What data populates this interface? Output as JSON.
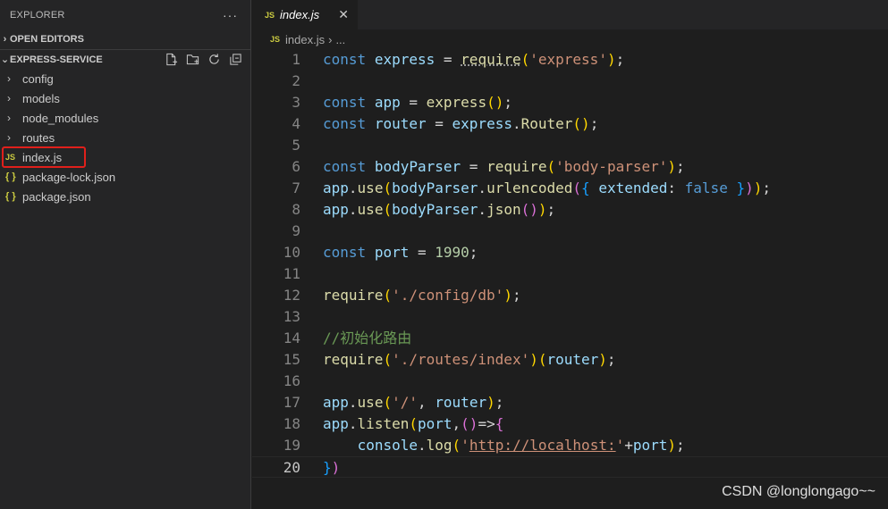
{
  "explorer": {
    "title": "EXPLORER",
    "more": "···",
    "open_editors": "OPEN EDITORS",
    "project": "EXPRESS-SERVICE",
    "items": [
      {
        "label": "config",
        "type": "folder"
      },
      {
        "label": "models",
        "type": "folder"
      },
      {
        "label": "node_modules",
        "type": "folder"
      },
      {
        "label": "routes",
        "type": "folder"
      },
      {
        "label": "index.js",
        "type": "js",
        "badge": "JS"
      },
      {
        "label": "package-lock.json",
        "type": "json",
        "badge": "{ }"
      },
      {
        "label": "package.json",
        "type": "json",
        "badge": "{ }"
      }
    ]
  },
  "tab": {
    "badge": "JS",
    "label": "index.js",
    "close": "✕"
  },
  "breadcrumb": {
    "badge": "JS",
    "file": "index.js",
    "sep": "›",
    "rest": "..."
  },
  "code_lines": [
    "const express = require('express');",
    "",
    "const app = express();",
    "const router = express.Router();",
    "",
    "const bodyParser = require('body-parser');",
    "app.use(bodyParser.urlencoded({ extended: false }));",
    "app.use(bodyParser.json());",
    "",
    "const port = 1990;",
    "",
    "require('./config/db');",
    "",
    "//初始化路由",
    "require('./routes/index')(router);",
    "",
    "app.use('/', router);",
    "app.listen(port,()=>{",
    "    console.log('http://localhost:'+port);",
    "})"
  ],
  "line_numbers": [
    "1",
    "2",
    "3",
    "4",
    "5",
    "6",
    "7",
    "8",
    "9",
    "10",
    "11",
    "12",
    "13",
    "14",
    "15",
    "16",
    "17",
    "18",
    "19",
    "20"
  ],
  "watermark": "CSDN @longlongago~~",
  "colors": {
    "keyword": "#569cd6",
    "variable": "#9cdcfe",
    "function": "#dcdcaa",
    "string": "#ce9178",
    "number": "#b5cea8",
    "comment": "#6a9955",
    "highlight": "#e0201b"
  }
}
